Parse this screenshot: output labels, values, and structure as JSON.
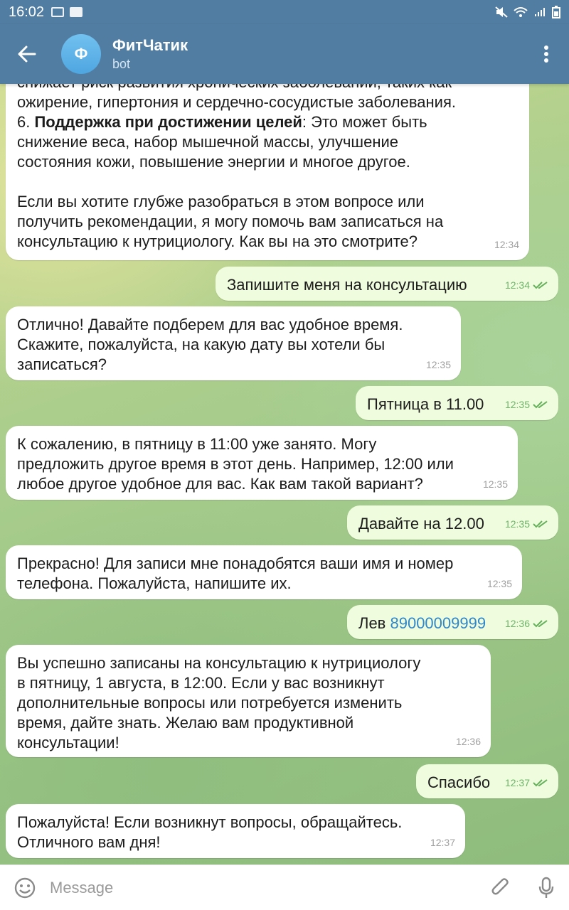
{
  "status_bar": {
    "time": "16:02"
  },
  "header": {
    "back_icon": "arrow-left-icon",
    "avatar_letter": "Ф",
    "title": "ФитЧатик",
    "subtitle": "bot",
    "menu_icon": "more-vertical-icon"
  },
  "messages": [
    {
      "dir": "in",
      "text_lines": [
        "снижает риск развития хронических заболеваний, таких как",
        "ожирение, гипертония и сердечно-сосудистые заболевания."
      ],
      "p6_prefix": "6. ",
      "p6_bold": "Поддержка при достижении целей",
      "p6_rest": ": Это может быть\nснижение веса, набор мышечной массы, улучшение\nсостояния кожи, повышение энергии и многое другое.",
      "p_last": "Если вы хотите глубже разобраться в этом вопросе или\nполучить рекомендации, я могу помочь вам записаться на\nконсультацию к нутрициологу. Как вы на это смотрите?",
      "time": "12:34"
    },
    {
      "dir": "out",
      "text": "Запишите меня на консультацию",
      "time": "12:34"
    },
    {
      "dir": "in",
      "text": "Отлично! Давайте подберем для вас удобное время.\nСкажите, пожалуйста, на какую дату вы хотели бы\nзаписаться?",
      "time": "12:35"
    },
    {
      "dir": "out",
      "text": "Пятница в 11.00",
      "time": "12:35"
    },
    {
      "dir": "in",
      "text": "К сожалению, в пятницу в 11:00 уже занято. Могу\nпредложить другое время в этот день. Например, 12:00 или\nлюбое другое удобное для вас. Как вам такой вариант?",
      "time": "12:35"
    },
    {
      "dir": "out",
      "text": "Давайте на 12.00",
      "time": "12:35"
    },
    {
      "dir": "in",
      "text": "Прекрасно! Для записи мне понадобятся ваши имя и номер\nтелефона. Пожалуйста, напишите их.",
      "time": "12:35"
    },
    {
      "dir": "out",
      "text_prefix": "Лев ",
      "phone": "89000009999",
      "time": "12:36"
    },
    {
      "dir": "in",
      "text": "Вы успешно записаны на консультацию к нутрициологу\nв пятницу, 1 августа, в 12:00. Если у вас возникнут\nдополнительные вопросы или потребуется изменить\nвремя, дайте знать. Желаю вам продуктивной\nконсультации!",
      "time": "12:36"
    },
    {
      "dir": "out",
      "text": "Спасибо",
      "time": "12:37"
    },
    {
      "dir": "in",
      "text": "Пожалуйста! Если возникнут вопросы, обращайтесь.\nОтличного вам дня!",
      "time": "12:37"
    }
  ],
  "input": {
    "placeholder": "Message",
    "emoji_icon": "emoji-icon",
    "attach_icon": "paperclip-icon",
    "mic_icon": "microphone-icon"
  },
  "colors": {
    "header": "#517da2",
    "bubble_in": "#ffffff",
    "bubble_out": "#effdde",
    "check": "#65b05b",
    "link": "#2f86c8"
  }
}
